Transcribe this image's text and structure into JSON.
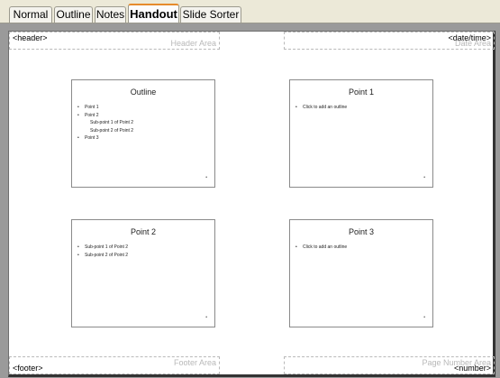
{
  "tabs": [
    {
      "label": "Normal"
    },
    {
      "label": "Outline"
    },
    {
      "label": "Notes"
    },
    {
      "label": "Handout"
    },
    {
      "label": "Slide Sorter"
    }
  ],
  "active_tab": "Handout",
  "areas": {
    "header": {
      "placeholder": "<header>",
      "label": "Header Area"
    },
    "date": {
      "placeholder": "<date/time>",
      "label": "Date Area"
    },
    "footer": {
      "placeholder": "<footer>",
      "label": "Footer Area"
    },
    "number": {
      "placeholder": "<number>",
      "label": "Page Number Area"
    }
  },
  "slides": [
    {
      "title": "Outline",
      "items": [
        "Point 1",
        "Point 2",
        "Sub-point 1 of Point 2",
        "Sub-point 2 of Point 2",
        "Point 3"
      ]
    },
    {
      "title": "Point 1",
      "items": [
        "Click to add an outline"
      ]
    },
    {
      "title": "Point 2",
      "items": [
        "Sub-point 1 of Point 2",
        "Sub-point 2 of Point 2"
      ]
    },
    {
      "title": "Point 3",
      "items": [
        "Click to add an outline"
      ]
    }
  ]
}
